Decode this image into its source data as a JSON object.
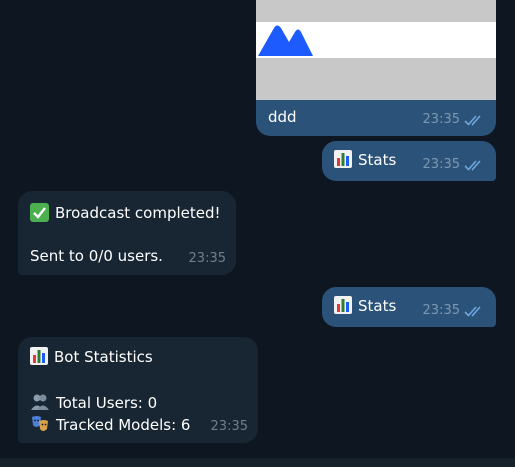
{
  "messages": {
    "media": {
      "caption": "ddd",
      "time": "23:35"
    },
    "stats_first": {
      "text": "Stats",
      "time": "23:35"
    },
    "broadcast": {
      "title": "Broadcast completed!",
      "detail": "Sent to 0/0 users.",
      "time": "23:35"
    },
    "stats_second": {
      "text": "Stats",
      "time": "23:35"
    },
    "bot_statistics": {
      "title": "Bot Statistics",
      "total_users": "Total Users: 0",
      "tracked_models": "Tracked Models: 6",
      "time": "23:35"
    }
  },
  "icons": {
    "read_receipt": "double-check-icon",
    "stats": "bar-chart-icon",
    "success": "check-mark-icon",
    "users": "users-icon",
    "models": "masks-icon"
  },
  "colors": {
    "background": "#0e1621",
    "outgoing_bubble": "#2b5278",
    "incoming_bubble": "#182533",
    "meta_text": "#7d98b1",
    "check_green": "#4caf50",
    "logo_blue": "#1e5bff"
  }
}
